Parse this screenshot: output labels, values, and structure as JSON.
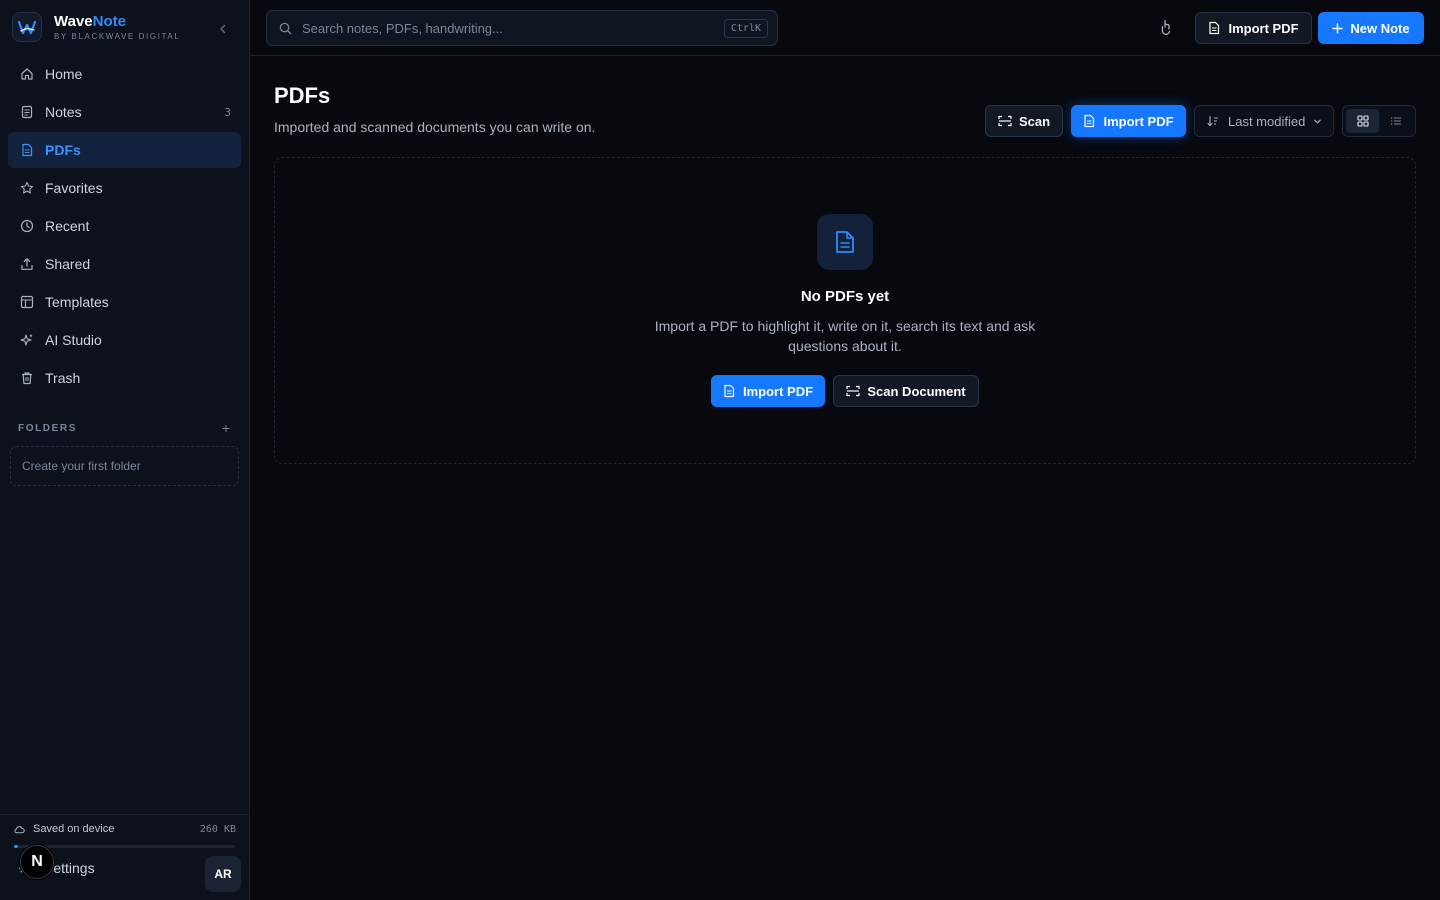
{
  "brand": {
    "name_part1": "Wave",
    "name_part2": "Note",
    "tagline": "BY BLACKWAVE DIGITAL"
  },
  "sidebar": {
    "items": [
      {
        "label": "Home",
        "icon": "home-icon"
      },
      {
        "label": "Notes",
        "icon": "note-icon",
        "count": "3"
      },
      {
        "label": "PDFs",
        "icon": "pdf-file-icon",
        "active": true
      },
      {
        "label": "Favorites",
        "icon": "star-icon"
      },
      {
        "label": "Recent",
        "icon": "clock-icon"
      },
      {
        "label": "Shared",
        "icon": "share-icon"
      },
      {
        "label": "Templates",
        "icon": "template-icon"
      },
      {
        "label": "AI Studio",
        "icon": "sparkle-icon"
      },
      {
        "label": "Trash",
        "icon": "trash-icon"
      }
    ],
    "folders_label": "FOLDERS",
    "folder_add": "+",
    "folder_empty": "Create your first folder",
    "storage": {
      "label": "Saved on device",
      "size": "260 KB",
      "used_fraction": 0.02
    },
    "settings_label": "Settings",
    "avatar_initials": "AR",
    "floating_badge": "N"
  },
  "topbar": {
    "search_placeholder": "Search notes, PDFs, handwriting...",
    "search_shortcut": "CtrlK",
    "import_pdf": "Import PDF",
    "new_note": "New Note"
  },
  "main": {
    "title": "PDFs",
    "subtitle": "Imported and scanned documents you can write on.",
    "scan": "Scan",
    "import_pdf": "Import PDF",
    "sort_label": "Last modified",
    "view_options": [
      "grid",
      "list"
    ],
    "view_active": "grid"
  },
  "empty_state": {
    "title": "No PDFs yet",
    "description": "Import a PDF to highlight it, write on it, search its text and ask questions about it.",
    "import_button": "Import PDF",
    "scan_button": "Scan Document"
  },
  "colors": {
    "accent": "#1677ff",
    "accent_text": "#3b93ff",
    "background": "#07090f",
    "sidebar": "#0c111b"
  }
}
